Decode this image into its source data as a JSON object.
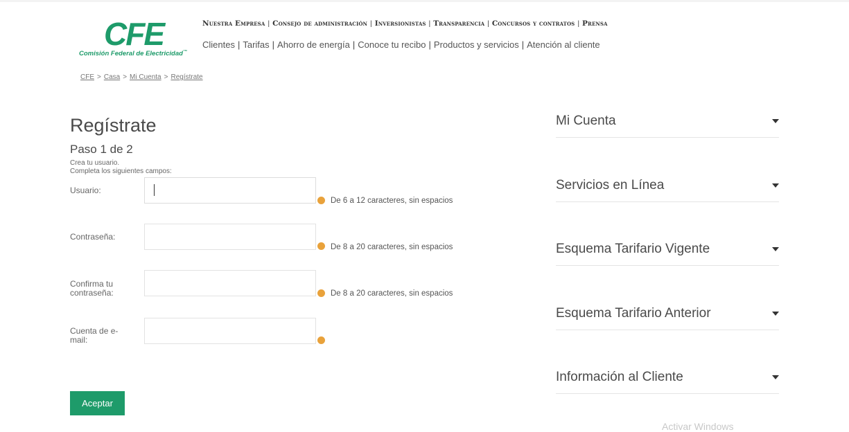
{
  "brand": {
    "logo_text": "CFE",
    "logo_subtitle": "Comisión Federal de Electricidad",
    "logo_trademark": "™",
    "green": "#1e9b6a",
    "hint_dot_color": "#e9a23b"
  },
  "nav": {
    "primary": [
      "Nuestra Empresa",
      "Consejo de administración",
      "Inversionistas",
      "Transparencia",
      "Concursos y contratos",
      "Prensa"
    ],
    "secondary": [
      "Clientes",
      "Tarifas",
      "Ahorro de energía",
      "Conoce tu recibo",
      "Productos y servicios",
      "Atención al cliente"
    ],
    "separator": "|"
  },
  "breadcrumb": [
    "CFE",
    "Casa",
    "Mi Cuenta",
    "Regístrate"
  ],
  "breadcrumb_separator": ">",
  "form": {
    "title": "Regístrate",
    "step": "Paso 1 de 2",
    "intro_line1": "Crea tu usuario.",
    "intro_line2": "Completa los siguientes campos:",
    "fields": [
      {
        "label": "Usuario:",
        "value": "",
        "hint": "De 6 a 12 caracteres, sin espacios"
      },
      {
        "label": "Contraseña:",
        "value": "",
        "hint": "De 8 a 20 caracteres, sin espacios"
      },
      {
        "label_line1": "Confirma tu",
        "label_line2": "contraseña:",
        "value": "",
        "hint": "De 8 a 20 caracteres, sin espacios"
      },
      {
        "label_line1": "Cuenta de e-",
        "label_line2": "mail:",
        "value": "",
        "hint": ""
      }
    ],
    "submit_label": "Aceptar"
  },
  "sidebar": {
    "items": [
      {
        "label": "Mi Cuenta"
      },
      {
        "label": "Servicios en Línea"
      },
      {
        "label": "Esquema Tarifario Vigente"
      },
      {
        "label": "Esquema Tarifario Anterior"
      },
      {
        "label": "Información al Cliente"
      }
    ]
  },
  "watermark": "Activar Windows"
}
